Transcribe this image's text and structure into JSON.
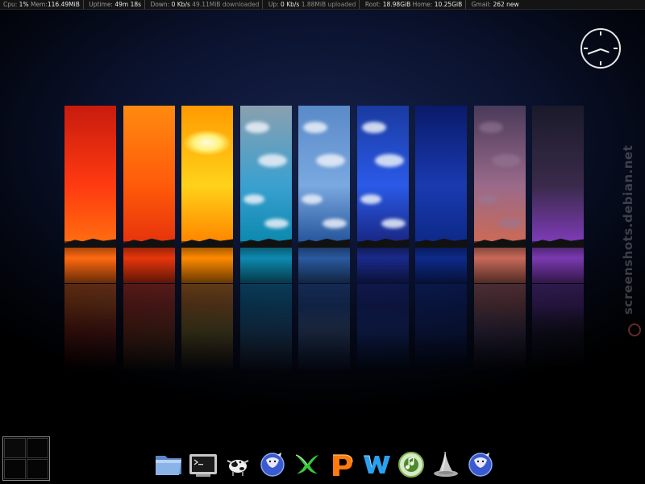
{
  "statusbar": {
    "cpu_label": "Cpu:",
    "cpu_value": "1%",
    "mem_label": "Mem:",
    "mem_value": "116.49MiB",
    "uptime_label": "Uptime:",
    "uptime_value": "49m 18s",
    "down_label": "Down:",
    "down_rate": "0 Kb/s",
    "down_total": "49.11MiB downloaded",
    "up_label": "Up:",
    "up_rate": "0 Kb/s",
    "up_total": "1.88MiB uploaded",
    "root_label": "Root:",
    "root_value": "18.98GiB",
    "home_label": "Home:",
    "home_value": "10.25GiB",
    "gmail_label": "Gmail:",
    "gmail_value": "262 new"
  },
  "watermark": "screenshots.debian.net",
  "wallpaper_strips": [
    {
      "name": "red",
      "top": "#c81b0e",
      "mid": "#ff3a10",
      "bottom": "#ff6a10"
    },
    {
      "name": "orange",
      "top": "#ff8a10",
      "mid": "#ff5a0a",
      "bottom": "#e8360c"
    },
    {
      "name": "yellow",
      "top": "#ff9a00",
      "mid": "#ffd21a",
      "bottom": "#ff8a00"
    },
    {
      "name": "teal",
      "top": "#8aa0b0",
      "mid": "#3aa0d0",
      "bottom": "#0e8ab0"
    },
    {
      "name": "sky-blue",
      "top": "#5a8ac8",
      "mid": "#7aa8e0",
      "bottom": "#2a5aa0"
    },
    {
      "name": "blue",
      "top": "#1a3aa0",
      "mid": "#2a5ae8",
      "bottom": "#1a2a8a"
    },
    {
      "name": "deep-blue",
      "top": "#0a1a6a",
      "mid": "#1a3ab0",
      "bottom": "#0e2a8a"
    },
    {
      "name": "purple-dusk",
      "top": "#4a3a5a",
      "mid": "#9a6a8a",
      "bottom": "#c86a5a"
    },
    {
      "name": "violet",
      "top": "#1a1a2a",
      "mid": "#3a2a4a",
      "bottom": "#7a3ab0"
    }
  ],
  "dock": [
    {
      "icon": "folder-icon"
    },
    {
      "icon": "terminal-icon"
    },
    {
      "icon": "cow-icon"
    },
    {
      "icon": "pidgin-icon"
    },
    {
      "icon": "spreadsheet-x-icon"
    },
    {
      "icon": "presentation-p-icon"
    },
    {
      "icon": "writer-w-icon"
    },
    {
      "icon": "music-player-icon"
    },
    {
      "icon": "wizard-hat-icon"
    },
    {
      "icon": "pidgin-icon-2"
    }
  ],
  "colors": {
    "background": "#0b1330",
    "statusbar_bg": "#141414",
    "statusbar_text": "#9a9a9a"
  }
}
